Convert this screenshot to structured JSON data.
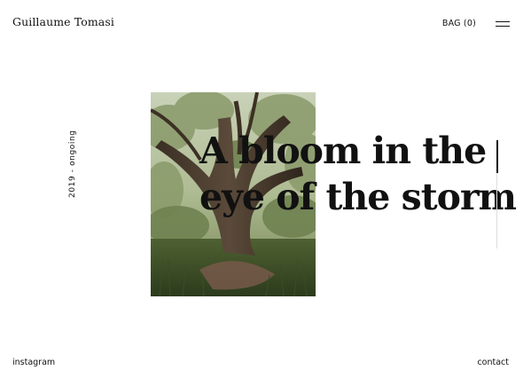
{
  "header": {
    "brand": "Guillaume Tomasi",
    "bag_label": "BAG (0)",
    "menu_icon": "hamburger-menu-icon"
  },
  "project": {
    "years": "2019 - ongoing",
    "title_line_1": "A bloom in the",
    "title_line_2": "eye of the storm",
    "image_subject": "tree-photograph"
  },
  "scroll": {
    "progress": 0.3
  },
  "footer": {
    "instagram": "instagram",
    "contact": "contact"
  },
  "colors": {
    "background": "#ffffff",
    "text": "#111111",
    "scroll_track": "#dddddd"
  }
}
